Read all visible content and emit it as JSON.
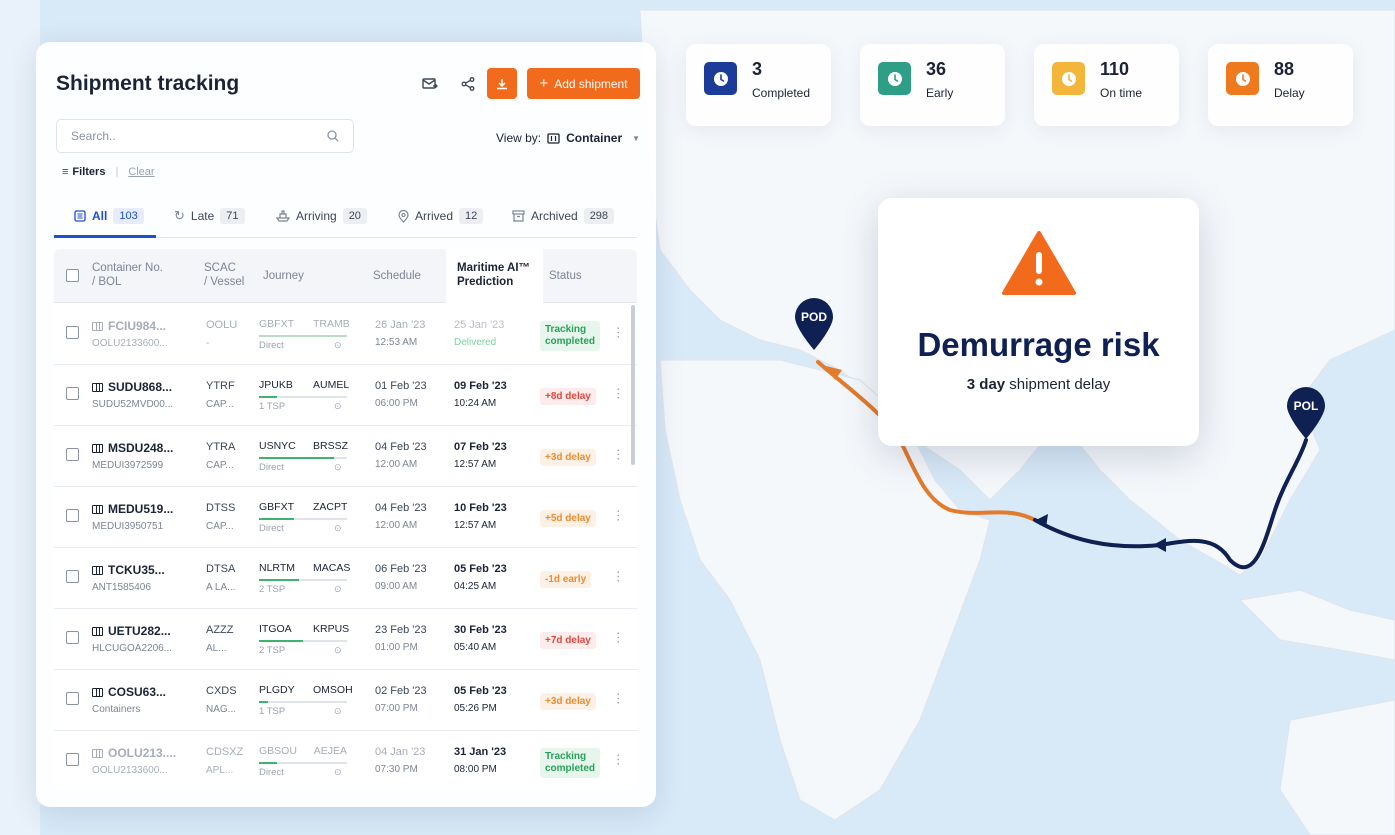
{
  "panel": {
    "title": "Shipment tracking",
    "add_label": "Add shipment",
    "search_placeholder": "Search..",
    "view_by_label": "View by:",
    "view_by_value": "Container",
    "filters_label": "Filters",
    "clear_label": "Clear"
  },
  "tabs": [
    {
      "label": "All",
      "count": "103"
    },
    {
      "label": "Late",
      "count": "71"
    },
    {
      "label": "Arriving",
      "count": "20"
    },
    {
      "label": "Arrived",
      "count": "12"
    },
    {
      "label": "Archived",
      "count": "298"
    }
  ],
  "columns": {
    "container_1": "Container No.",
    "container_2": "/ BOL",
    "scac_1": "SCAC",
    "scac_2": "/ Vessel",
    "journey": "Journey",
    "schedule": "Schedule",
    "pred_1": "Maritime AI™",
    "pred_2": "Prediction",
    "status": "Status"
  },
  "rows": [
    {
      "container": "FCIU984...",
      "bol": "OOLU2133600...",
      "scac": "OOLU",
      "vessel": "-",
      "from": "GBFXT",
      "to": "TRAMB",
      "mode": "Direct",
      "sched_date": "26 Jan '23",
      "sched_time": "12:53 AM",
      "pred_date": "25 Jan '23",
      "pred_time": "Delivered",
      "status": "Tracking completed",
      "status_1": "Tracking",
      "status_2": "completed",
      "kind": "green",
      "progress": 1.0,
      "dim": true
    },
    {
      "container": "SUDU868...",
      "bol": "SUDU52MVD00...",
      "scac": "YTRF",
      "vessel": "CAP...",
      "from": "JPUKB",
      "to": "AUMEL",
      "mode": "1 TSP",
      "sched_date": "01 Feb '23",
      "sched_time": "06:00 PM",
      "pred_date": "09 Feb '23",
      "pred_time": "10:24 AM",
      "status": "+8d delay",
      "kind": "red",
      "progress": 0.2,
      "dim": false
    },
    {
      "container": "MSDU248...",
      "bol": "MEDUI3972599",
      "scac": "YTRA",
      "vessel": "CAP...",
      "from": "USNYC",
      "to": "BRSSZ",
      "mode": "Direct",
      "sched_date": "04 Feb '23",
      "sched_time": "12:00 AM",
      "pred_date": "07 Feb '23",
      "pred_time": "12:57 AM",
      "status": "+3d delay",
      "kind": "orange",
      "progress": 0.85,
      "dim": false
    },
    {
      "container": "MEDU519...",
      "bol": "MEDUI3950751",
      "scac": "DTSS",
      "vessel": "CAP...",
      "from": "GBFXT",
      "to": "ZACPT",
      "mode": "Direct",
      "sched_date": "04 Feb '23",
      "sched_time": "12:00 AM",
      "pred_date": "10 Feb '23",
      "pred_time": "12:57 AM",
      "status": "+5d delay",
      "kind": "orange",
      "progress": 0.4,
      "dim": false
    },
    {
      "container": "TCKU35...",
      "bol": "ANT1585406",
      "scac": "DTSA",
      "vessel": "A LA...",
      "from": "NLRTM",
      "to": "MACAS",
      "mode": "2 TSP",
      "sched_date": "06 Feb '23",
      "sched_time": "09:00 AM",
      "pred_date": "05 Feb '23",
      "pred_time": "04:25 AM",
      "status": "-1d early",
      "kind": "orange",
      "progress": 0.45,
      "dim": false
    },
    {
      "container": "UETU282...",
      "bol": "HLCUGOA2206...",
      "scac": "AZZZ",
      "vessel": "AL...",
      "from": "ITGOA",
      "to": "KRPUS",
      "mode": "2 TSP",
      "sched_date": "23 Feb '23",
      "sched_time": "01:00 PM",
      "pred_date": "30 Feb '23",
      "pred_time": "05:40 AM",
      "status": "+7d delay",
      "kind": "red",
      "progress": 0.5,
      "dim": false
    },
    {
      "container": "COSU63...",
      "bol": "Containers",
      "scac": "CXDS",
      "vessel": "NAG...",
      "from": "PLGDY",
      "to": "OMSOH",
      "mode": "1 TSP",
      "sched_date": "02 Feb '23",
      "sched_time": "07:00 PM",
      "pred_date": "05 Feb '23",
      "pred_time": "05:26 PM",
      "status": "+3d delay",
      "kind": "orange",
      "progress": 0.1,
      "dim": false
    },
    {
      "container": "OOLU213....",
      "bol": "OOLU2133600...",
      "scac": "CDSXZ",
      "vessel": "APL...",
      "from": "GBSOU",
      "to": "AEJEA",
      "mode": "Direct",
      "sched_date": "04 Jan '23",
      "sched_time": "07:30 PM",
      "pred_date": "31 Jan '23",
      "pred_time": "08:00 PM",
      "status": "Tracking completed",
      "status_1": "Tracking",
      "status_2": "completed",
      "kind": "green",
      "progress": 0.2,
      "dim": true
    }
  ],
  "stats": [
    {
      "value": "3",
      "label": "Completed",
      "color": "#1d3c9a",
      "icon": "clock-icon"
    },
    {
      "value": "36",
      "label": "Early",
      "color": "#2f9e86",
      "icon": "clock-icon"
    },
    {
      "value": "110",
      "label": "On time",
      "color": "#f3b53a",
      "icon": "clock-icon"
    },
    {
      "value": "88",
      "label": "Delay",
      "color": "#ef7a1e",
      "icon": "clock-icon"
    }
  ],
  "alert": {
    "title": "Demurrage risk",
    "sub_bold": "3 day",
    "sub_rest": " shipment delay"
  },
  "pins": {
    "pod": "POD",
    "pol": "POL"
  },
  "colors": {
    "accent": "#f26b1d",
    "navy": "#0f2053",
    "link": "#1f4fd1"
  }
}
